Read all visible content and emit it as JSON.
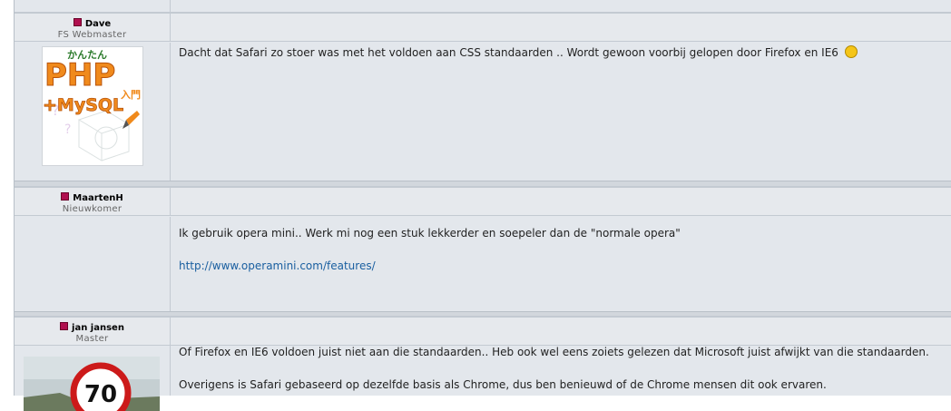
{
  "posts": [
    {
      "username": "Dave",
      "title": "FS Webmaster",
      "avatar_icon": "php-mysql-book-avatar",
      "lines": [
        "Dacht dat Safari zo stoer was met het voldoen aan CSS standaarden .. Wordt gewoon voorbij gelopen door Firefox en IE6"
      ]
    },
    {
      "username": "MaartenH",
      "title": "Nieuwkomer",
      "lines": [
        "Ik gebruik opera mini.. Werk mi nog een stuk lekkerder en soepeler dan de \"normale opera\""
      ],
      "link": "http://www.operamini.com/features/"
    },
    {
      "username": "jan jansen",
      "title": "Master",
      "avatar_icon": "speed-sign-70-avatar",
      "lines": [
        "Of Firefox en IE6 voldoen juist niet aan die standaarden.. Heb ook wel eens zoiets gelezen dat Microsoft juist afwijkt van die standaarden.",
        "Overigens is Safari gebaseerd op dezelfde basis als Chrome, dus ben benieuwd of de Chrome mensen dit ook ervaren."
      ]
    }
  ],
  "avatar_php": {
    "line1": "PHP",
    "line2": "+MySQL",
    "jp": "入門",
    "small": "かんたん"
  },
  "avatar_speed": {
    "value": "70"
  },
  "colors": {
    "status_online": "#b0104f",
    "link": "#1a5fa0",
    "row_bg": "#e3e7ec"
  }
}
